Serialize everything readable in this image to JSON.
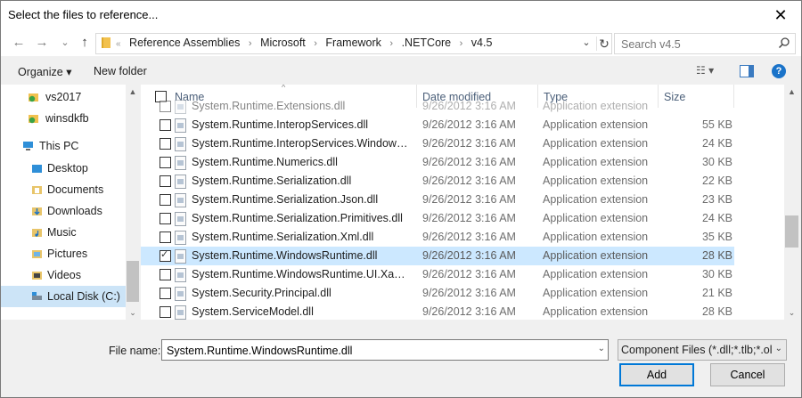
{
  "window": {
    "title": "Select the files to reference...",
    "close_glyph": "✕"
  },
  "nav": {
    "back": "←",
    "forward": "→",
    "recent": "⌄",
    "up": "↑"
  },
  "address": {
    "lead_chevron": "«",
    "crumbs": [
      "Reference Assemblies",
      "Microsoft",
      "Framework",
      ".NETCore",
      "v4.5"
    ],
    "separator": "›",
    "dropdown": "⌄",
    "refresh": "↻"
  },
  "search": {
    "placeholder": "Search v4.5"
  },
  "commands": {
    "organize": "Organize ▾",
    "new_folder": "New folder",
    "view_menu": "☷ ▾",
    "help": "?"
  },
  "sidebar": {
    "items": [
      {
        "label": "vs2017",
        "icon": "folder-shield-icon"
      },
      {
        "label": "winsdkfb",
        "icon": "folder-shield-icon"
      },
      {
        "label": "This PC",
        "icon": "computer-icon"
      },
      {
        "label": "Desktop",
        "icon": "desktop-folder-icon"
      },
      {
        "label": "Documents",
        "icon": "documents-folder-icon"
      },
      {
        "label": "Downloads",
        "icon": "downloads-folder-icon"
      },
      {
        "label": "Music",
        "icon": "music-folder-icon"
      },
      {
        "label": "Pictures",
        "icon": "pictures-folder-icon"
      },
      {
        "label": "Videos",
        "icon": "videos-folder-icon"
      },
      {
        "label": "Local Disk (C:)",
        "icon": "disk-drive-icon"
      }
    ],
    "scroll_up": "▲",
    "scroll_down": "⌄"
  },
  "columns": {
    "name": "Name",
    "date": "Date modified",
    "type": "Type",
    "size": "Size",
    "sort_glyph": "^"
  },
  "files": [
    {
      "name": "System.Runtime.Extensions.dll",
      "date": "9/26/2012 3:16 AM",
      "type": "Application extension",
      "size": "",
      "checked": false
    },
    {
      "name": "System.Runtime.InteropServices.dll",
      "date": "9/26/2012 3:16 AM",
      "type": "Application extension",
      "size": "55 KB",
      "checked": false
    },
    {
      "name": "System.Runtime.InteropServices.WindowsRu...",
      "date": "9/26/2012 3:16 AM",
      "type": "Application extension",
      "size": "24 KB",
      "checked": false
    },
    {
      "name": "System.Runtime.Numerics.dll",
      "date": "9/26/2012 3:16 AM",
      "type": "Application extension",
      "size": "30 KB",
      "checked": false
    },
    {
      "name": "System.Runtime.Serialization.dll",
      "date": "9/26/2012 3:16 AM",
      "type": "Application extension",
      "size": "22 KB",
      "checked": false
    },
    {
      "name": "System.Runtime.Serialization.Json.dll",
      "date": "9/26/2012 3:16 AM",
      "type": "Application extension",
      "size": "23 KB",
      "checked": false
    },
    {
      "name": "System.Runtime.Serialization.Primitives.dll",
      "date": "9/26/2012 3:16 AM",
      "type": "Application extension",
      "size": "24 KB",
      "checked": false
    },
    {
      "name": "System.Runtime.Serialization.Xml.dll",
      "date": "9/26/2012 3:16 AM",
      "type": "Application extension",
      "size": "35 KB",
      "checked": false
    },
    {
      "name": "System.Runtime.WindowsRuntime.dll",
      "date": "9/26/2012 3:16 AM",
      "type": "Application extension",
      "size": "28 KB",
      "checked": true
    },
    {
      "name": "System.Runtime.WindowsRuntime.UI.Xaml.dll",
      "date": "9/26/2012 3:16 AM",
      "type": "Application extension",
      "size": "30 KB",
      "checked": false
    },
    {
      "name": "System.Security.Principal.dll",
      "date": "9/26/2012 3:16 AM",
      "type": "Application extension",
      "size": "21 KB",
      "checked": false
    },
    {
      "name": "System.ServiceModel.dll",
      "date": "9/26/2012 3:16 AM",
      "type": "Application extension",
      "size": "28 KB",
      "checked": false
    }
  ],
  "bottom": {
    "file_name_label": "File name:",
    "file_name_value": "System.Runtime.WindowsRuntime.dll",
    "file_type_value": "Component Files (*.dll;*.tlb;*.olb",
    "dropdown": "⌄",
    "add_label": "Add",
    "cancel_label": "Cancel"
  },
  "colors": {
    "selection": "#cce8ff",
    "accent": "#0078d7"
  }
}
